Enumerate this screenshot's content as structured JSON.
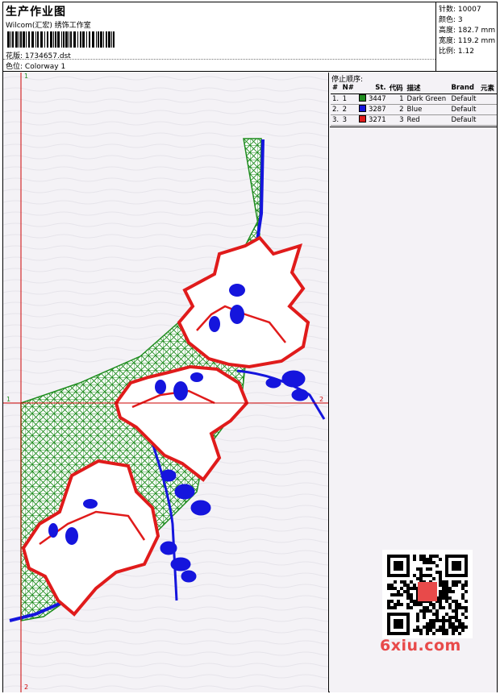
{
  "header": {
    "title": "生产作业图",
    "studio": "Wilcom(汇宏) 绣饰工作室",
    "design_label": "花版:",
    "design_value": "1734657.dst",
    "colorway_label": "色位:",
    "colorway_value": "Colorway 1"
  },
  "stats": [
    {
      "label": "针数:",
      "value": "10007"
    },
    {
      "label": "颜色:",
      "value": "3"
    },
    {
      "label": "高度:",
      "value": "182.7 mm"
    },
    {
      "label": "宽度:",
      "value": "119.2 mm"
    },
    {
      "label": "比例:",
      "value": "1.12"
    }
  ],
  "stop_sequence": {
    "title": "停止顺序:",
    "columns": [
      "#",
      "N#",
      "St.",
      "代码",
      "描述",
      "Brand",
      "元素"
    ],
    "rows": [
      {
        "idx": "1.",
        "n": "1",
        "color": "#1e8c1e",
        "st": "3447",
        "code": "1",
        "desc": "Dark Green",
        "brand": "Default",
        "elem": ""
      },
      {
        "idx": "2.",
        "n": "2",
        "color": "#1515dd",
        "st": "3287",
        "code": "2",
        "desc": "Blue",
        "brand": "Default",
        "elem": ""
      },
      {
        "idx": "3.",
        "n": "3",
        "color": "#e01b1b",
        "st": "3271",
        "code": "3",
        "desc": "Red",
        "brand": "Default",
        "elem": ""
      }
    ]
  },
  "axes": {
    "top_label": "1",
    "left_label": "1",
    "right_label": "2",
    "bottom_label": "2"
  },
  "colors": {
    "green": "#1e8c1e",
    "blue": "#1515dd",
    "red": "#e01b1b",
    "axis_red": "#cc0000",
    "axis_green": "#1f8a1f"
  },
  "watermark": {
    "site": "6xiu.com"
  }
}
